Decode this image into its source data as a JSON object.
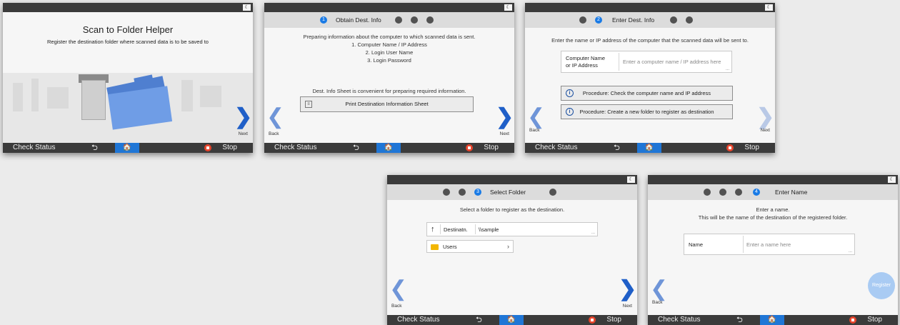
{
  "common": {
    "check_status": "Check Status",
    "stop": "Stop",
    "back_glyph": "⮌",
    "home_glyph": "🏠",
    "moon_glyph": "☾",
    "back_label": "Back",
    "next_label": "Next",
    "accent_color": "#1a7be6",
    "stop_color": "#e8452c"
  },
  "screen1": {
    "title": "Scan to Folder Helper",
    "subtitle": "Register the destination folder where scanned data is to be saved to"
  },
  "screen2": {
    "step_active": "1",
    "step_label": "Obtain Dest. Info",
    "intro": "Preparing information about the computer to which scanned data is sent.",
    "list": [
      "1. Computer Name / IP Address",
      "2. Login User Name",
      "3. Login Password"
    ],
    "sheet_hint": "Dest. Info Sheet is convenient for preparing required information.",
    "print_button": "Print Destination Information Sheet"
  },
  "screen3": {
    "step_active": "2",
    "step_label": "Enter Dest. Info",
    "intro": "Enter the name or IP address of the computer that the scanned data will be sent to.",
    "field_label_line1": "Computer Name",
    "field_label_line2": "or IP Address",
    "field_placeholder": "Enter a computer name / IP address here",
    "procedure1": "Procedure: Check the computer name and IP address",
    "procedure2": "Procedure: Create a new folder to register as destination"
  },
  "screen4": {
    "step_active": "3",
    "step_label": "Select Folder",
    "intro": "Select a folder to register as the destination.",
    "dest_label": "Destinatn.",
    "dest_value": "\\\\sample",
    "folder_item": "Users"
  },
  "screen5": {
    "step_active": "4",
    "step_label": "Enter Name",
    "intro_line1": "Enter a name.",
    "intro_line2": "This will be the name of the destination of the registered folder.",
    "name_label": "Name",
    "name_placeholder": "Enter a name here",
    "register_button": "Register"
  }
}
